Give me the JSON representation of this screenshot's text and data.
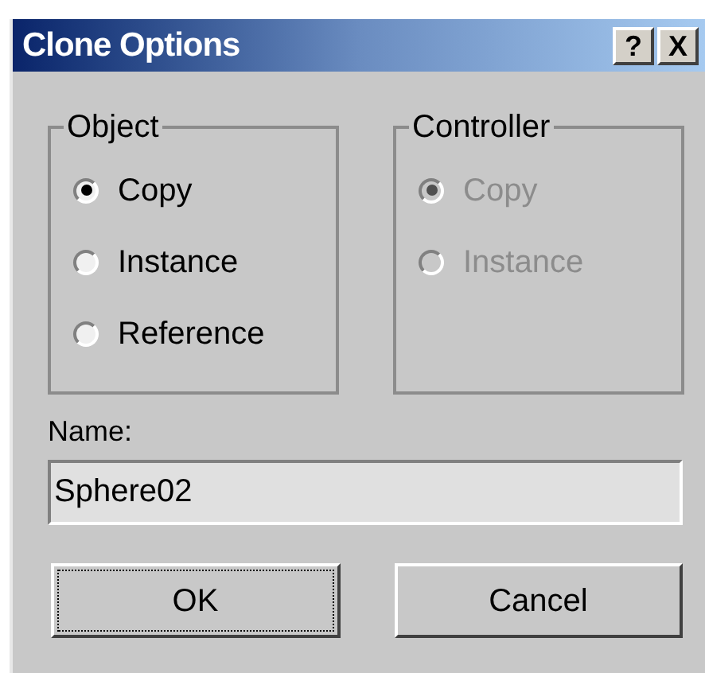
{
  "window": {
    "title": "Clone Options",
    "title_buttons": [
      "?",
      "X"
    ]
  },
  "groups": [
    {
      "label": "Object",
      "disabled": false,
      "options": [
        {
          "label": "Copy",
          "selected": true
        },
        {
          "label": "Instance",
          "selected": false
        },
        {
          "label": "Reference",
          "selected": false
        }
      ]
    },
    {
      "label": "Controller",
      "disabled": true,
      "options": [
        {
          "label": "Copy",
          "selected": true
        },
        {
          "label": "Instance",
          "selected": false
        }
      ]
    }
  ],
  "name": {
    "label": "Name:",
    "value": "Sphere02"
  },
  "buttons": [
    {
      "label": "OK",
      "focused": true
    },
    {
      "label": "Cancel",
      "focused": false
    }
  ]
}
